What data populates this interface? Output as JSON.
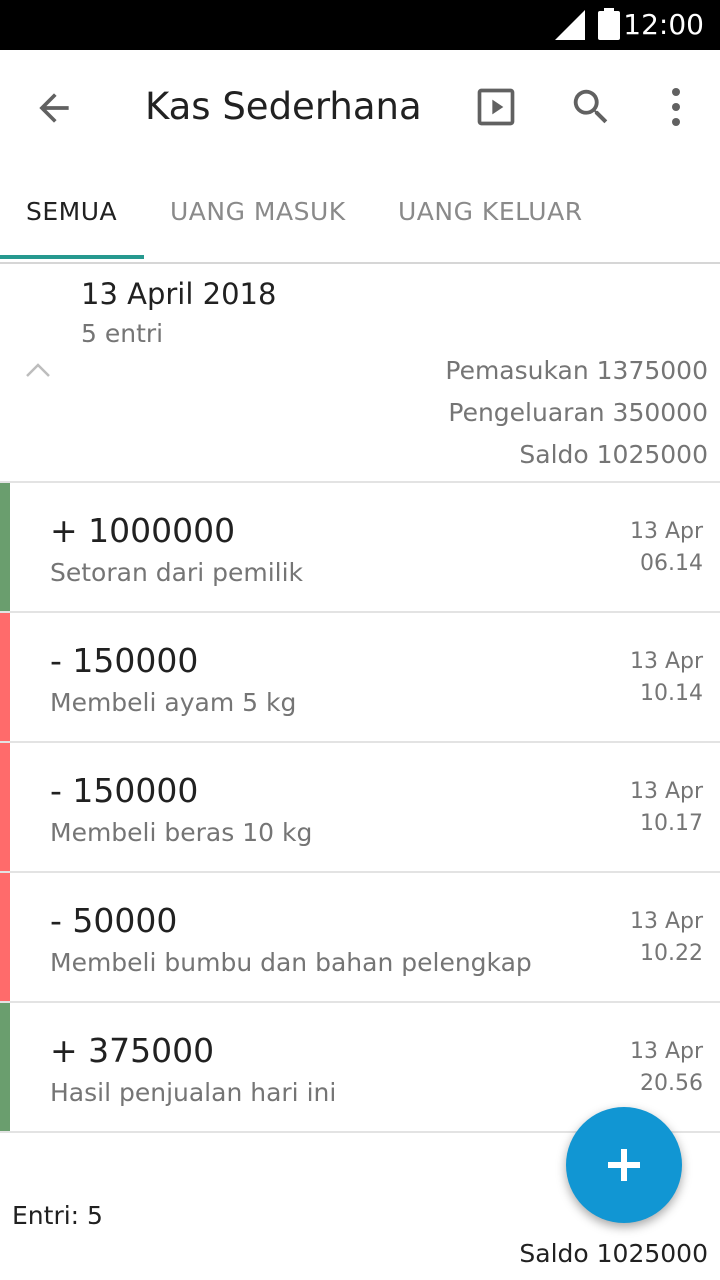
{
  "status_bar": {
    "time": "12:00"
  },
  "app_bar": {
    "title": "Kas Sederhana",
    "icons": [
      "back-arrow-icon",
      "play-icon",
      "search-icon",
      "more-vert-icon"
    ]
  },
  "tabs": [
    {
      "label": "SEMUA",
      "active": true
    },
    {
      "label": "UANG MASUK",
      "active": false
    },
    {
      "label": "UANG KELUAR",
      "active": false
    }
  ],
  "summary": {
    "date": "13 April 2018",
    "count": "5 entri",
    "income": "Pemasukan 1375000",
    "expense": "Pengeluaran 350000",
    "balance": "Saldo 1025000"
  },
  "entries": [
    {
      "amount": "+ 1000000",
      "description": "Setoran dari pemilik",
      "date": "13 Apr",
      "time": "06.14",
      "type": "income"
    },
    {
      "amount": "- 150000",
      "description": "Membeli ayam 5 kg",
      "date": "13 Apr",
      "time": "10.14",
      "type": "expense"
    },
    {
      "amount": "- 150000",
      "description": "Membeli beras 10 kg",
      "date": "13 Apr",
      "time": "10.17",
      "type": "expense"
    },
    {
      "amount": "- 50000",
      "description": "Membeli bumbu dan bahan pelengkap",
      "date": "13 Apr",
      "time": "10.22",
      "type": "expense"
    },
    {
      "amount": "+ 375000",
      "description": "Hasil penjualan hari ini",
      "date": "13 Apr",
      "time": "20.56",
      "type": "income"
    }
  ],
  "footer": {
    "count": "Entri: 5",
    "balance": "Saldo 1025000"
  },
  "colors": {
    "income": "#6a9e6e",
    "expense": "#ff6b6b",
    "accent": "#26998f",
    "fab": "#1196d3"
  }
}
